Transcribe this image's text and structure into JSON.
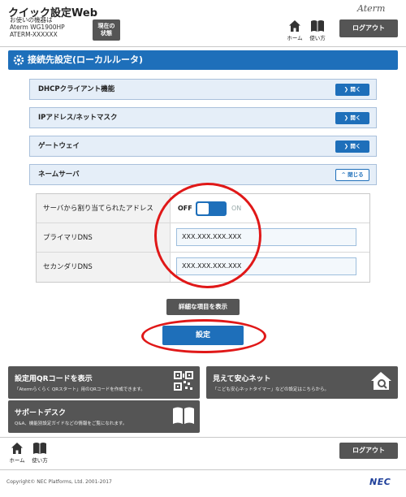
{
  "header": {
    "app_title": "クイック設定Web",
    "device_line1": "お使いの機器は",
    "device_line2": "Aterm WG1900HP",
    "device_line3": "ATERM-XXXXXX",
    "status_button_line1": "現在の",
    "status_button_line2": "状態",
    "brand": "Aterm",
    "home_label": "ホーム",
    "manual_label": "使い方",
    "logout_label": "ログアウト"
  },
  "section": {
    "title": "接続先設定(ローカルルータ)"
  },
  "accordions": [
    {
      "label": "DHCPクライアント機能",
      "button": "開く"
    },
    {
      "label": "IPアドレス/ネットマスク",
      "button": "開く"
    },
    {
      "label": "ゲートウェイ",
      "button": "開く"
    },
    {
      "label": "ネームサーバ",
      "button": "閉じる"
    }
  ],
  "form": {
    "auto_assign_label": "サーバから割り当てられたアドレス",
    "toggle_off": "OFF",
    "toggle_on": "ON",
    "toggle_state": "off",
    "primary_dns_label": "プライマリDNS",
    "primary_dns_value": "XXX.XXX.XXX.XXX",
    "secondary_dns_label": "セカンダリDNS",
    "secondary_dns_value": "XXX.XXX.XXX.XXX"
  },
  "actions": {
    "detail_label": "詳細な項目を表示",
    "submit_label": "設定"
  },
  "tiles": [
    {
      "title": "設定用QRコードを表示",
      "desc": "「Atermらくらく QRスタート」用のQRコードを作成できます。"
    },
    {
      "title": "見えて安心ネット",
      "desc": "「こども安心ネットタイマー」などの設定はこちらから。"
    },
    {
      "title": "サポートデスク",
      "desc": "Q&A、機能別設定ガイドなどの情報をご覧になれます。"
    }
  ],
  "footer": {
    "home_label": "ホーム",
    "manual_label": "使い方",
    "logout_label": "ログアウト",
    "copyright": "Copyright© NEC Platforms, Ltd. 2001-2017",
    "logo": "NEC"
  },
  "colors": {
    "accent": "#1e6fba",
    "dark_button": "#555555",
    "highlight_ring": "#e01818"
  }
}
